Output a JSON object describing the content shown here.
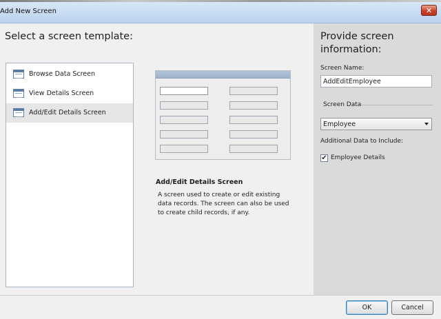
{
  "window": {
    "title": "Add New Screen",
    "close_glyph": "✕"
  },
  "main": {
    "heading": "Select a screen template:",
    "templates": [
      {
        "label": "Browse Data Screen",
        "icon": "grid-icon"
      },
      {
        "label": "View Details Screen",
        "icon": "grid-icon"
      },
      {
        "label": "Add/Edit Details Screen",
        "icon": "grid-icon",
        "selected": true
      }
    ],
    "description": {
      "title": "Add/Edit Details Screen",
      "text": "A screen used to create or edit existing data records. The screen can also be used to create child records, if any."
    }
  },
  "info": {
    "heading": "Provide screen information:",
    "screen_name_label": "Screen Name:",
    "screen_name_value": "AddEditEmployee",
    "screen_data_label": "Screen Data",
    "screen_data_value": "Employee",
    "additional_label": "Additional Data to Include:",
    "checkbox_label": "Employee Details",
    "checkbox_checked": true,
    "check_glyph": "✔"
  },
  "footer": {
    "ok_label": "OK",
    "cancel_label": "Cancel"
  }
}
